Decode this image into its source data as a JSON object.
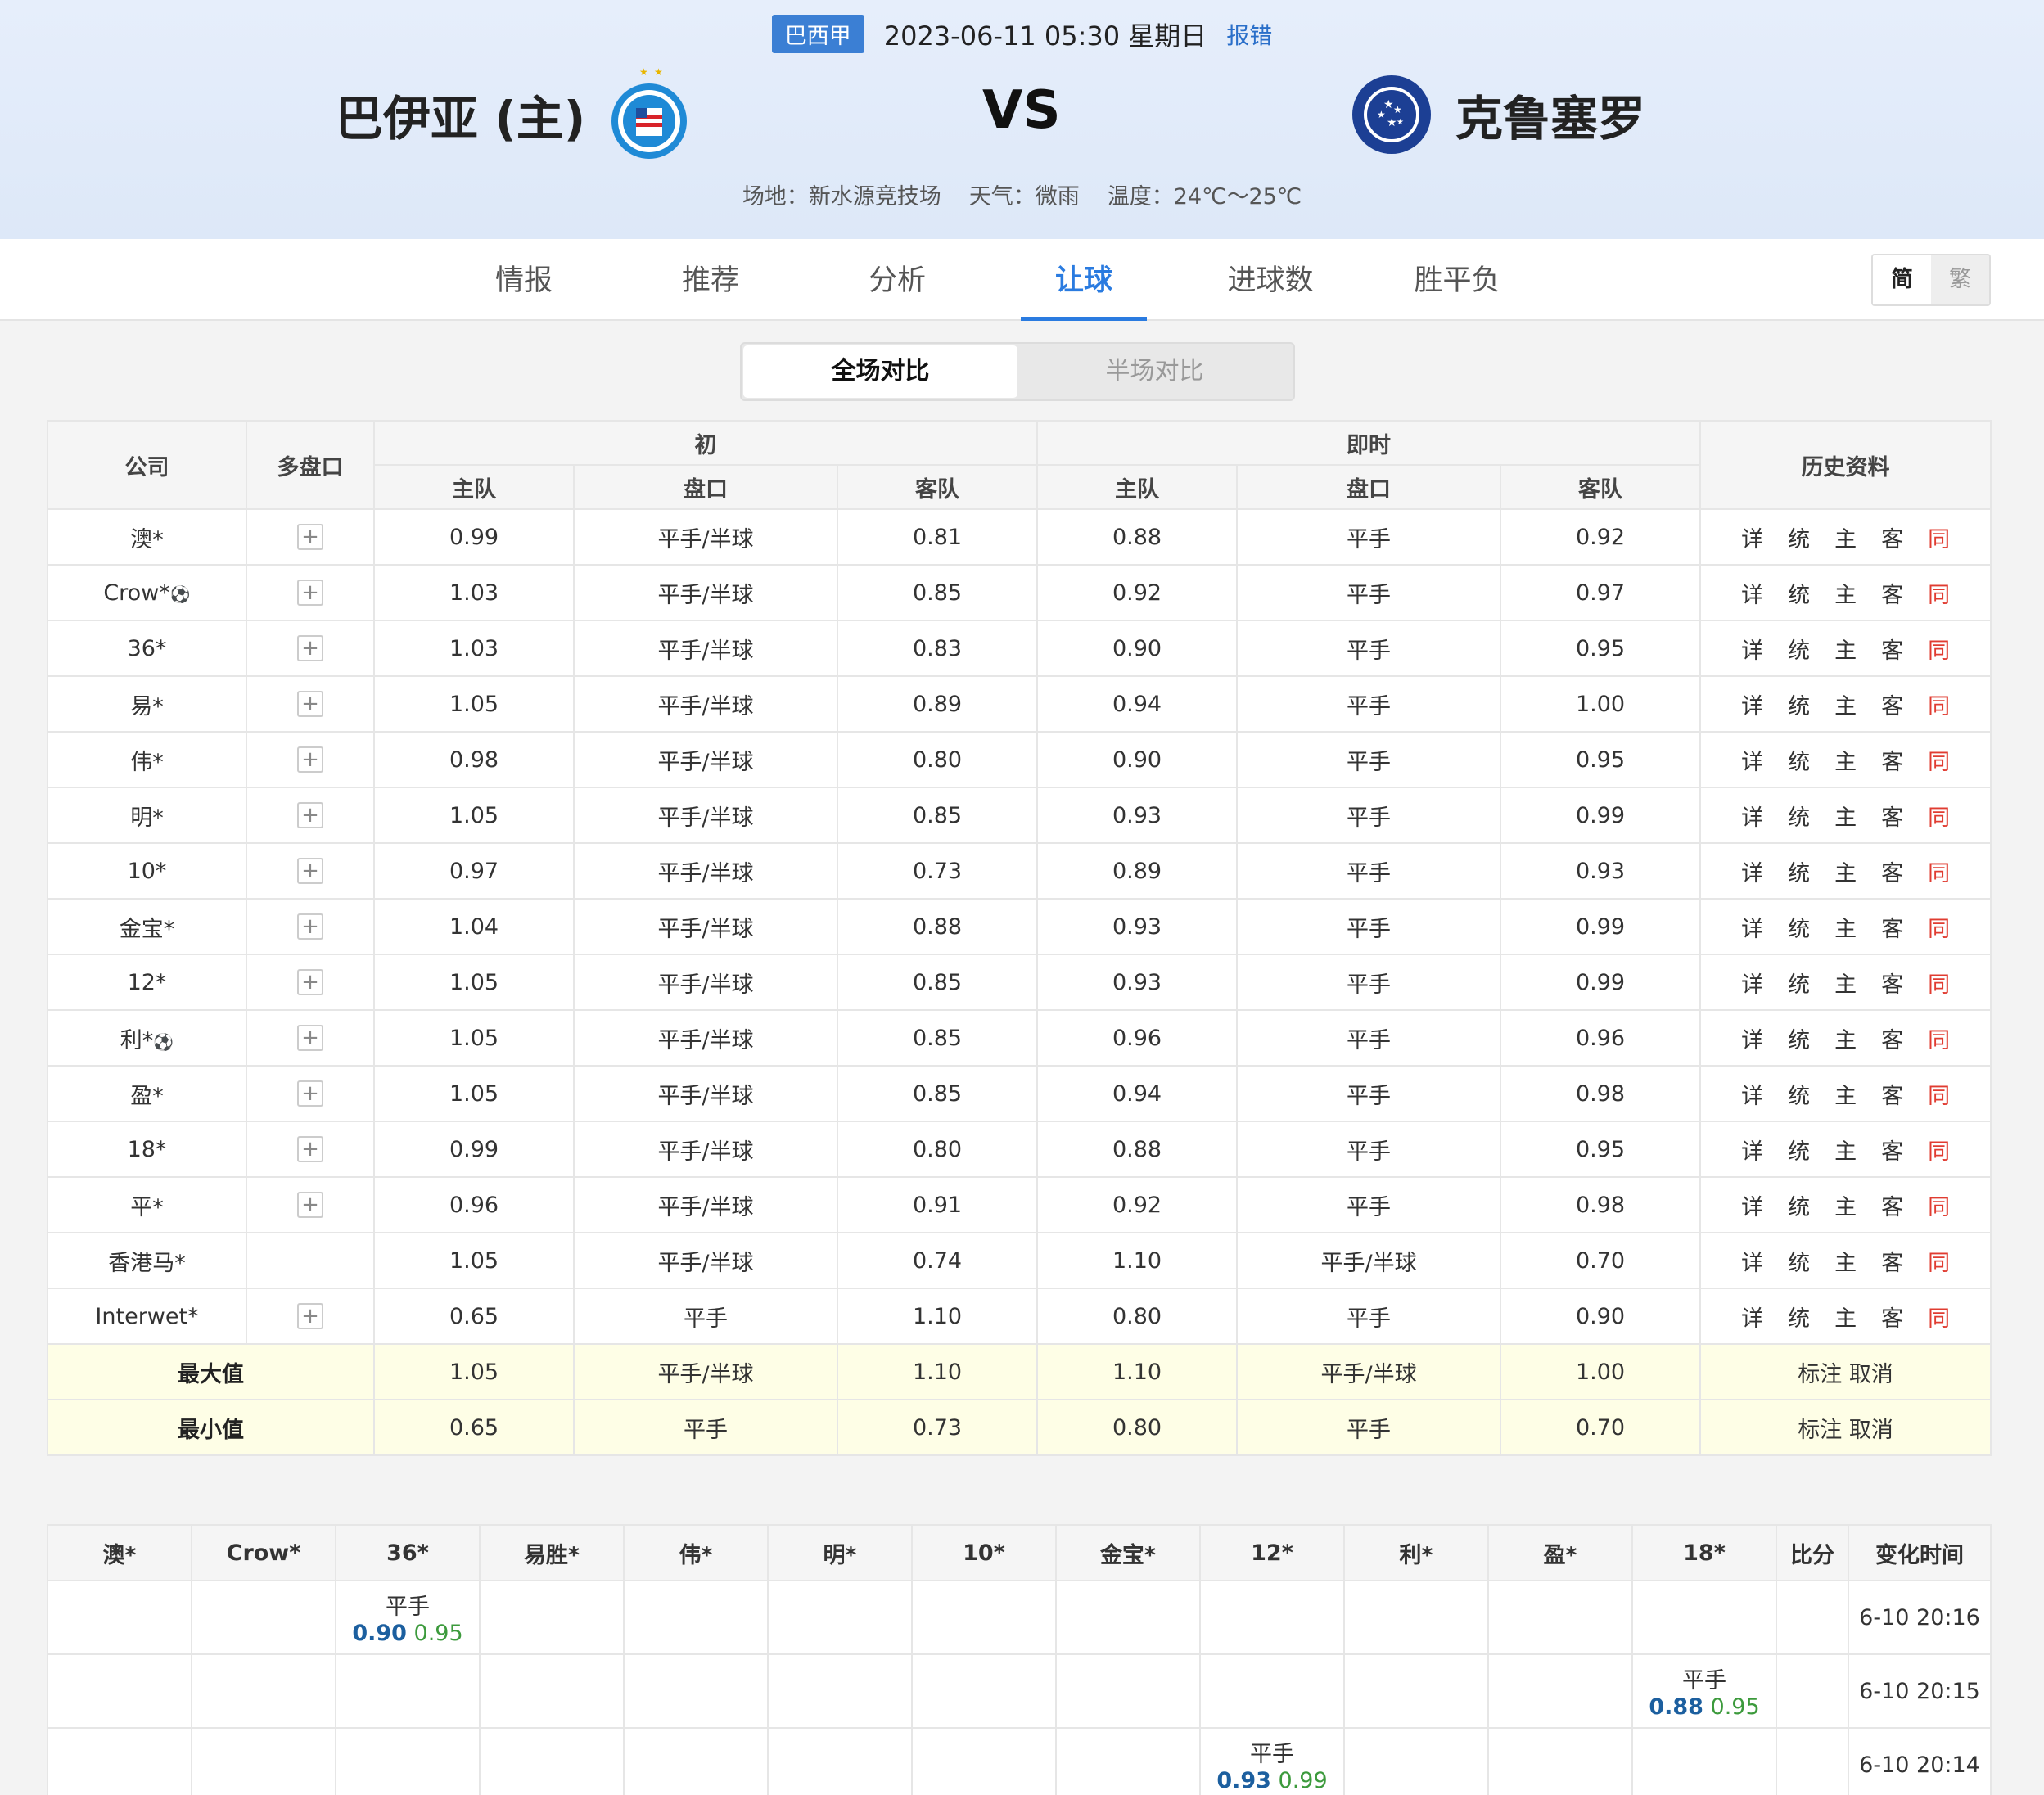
{
  "header": {
    "league": "巴西甲",
    "datetime": "2023-06-11 05:30 星期日",
    "report": "报错",
    "home_team": "巴伊亚 (主)",
    "away_team": "克鲁塞罗",
    "vs": "VS",
    "venue": "场地：新水源竞技场",
    "weather": "天气：微雨",
    "temperature": "温度：24℃～25℃",
    "home_logo_text": "ESPORTE CLUBE BAHIA",
    "away_logo_text": "CRUZEIRO ESPORTE CLUBE"
  },
  "nav": {
    "tabs": [
      "情报",
      "推荐",
      "分析",
      "让球",
      "进球数",
      "胜平负"
    ],
    "active": "让球",
    "lang_simplified": "简",
    "lang_traditional": "繁"
  },
  "segment": {
    "full": "全场对比",
    "half": "半场对比"
  },
  "odds_table": {
    "headers": {
      "company": "公司",
      "multi": "多盘口",
      "initial": "初",
      "live": "即时",
      "history": "历史资料",
      "home": "主队",
      "line": "盘口",
      "away": "客队"
    },
    "history_links": [
      "详",
      "统",
      "主",
      "客",
      "同"
    ],
    "rows": [
      {
        "company": "澳*",
        "ball": "",
        "plus": "+",
        "i_home": "0.99",
        "i_line": "平手/半球",
        "i_away": "0.81",
        "l_home": "0.88",
        "l_line": "平手",
        "l_away": "0.92"
      },
      {
        "company": "Crow*",
        "ball": "⚽",
        "plus": "+",
        "i_home": "1.03",
        "i_line": "平手/半球",
        "i_away": "0.85",
        "l_home": "0.92",
        "l_line": "平手",
        "l_away": "0.97"
      },
      {
        "company": "36*",
        "ball": "",
        "plus": "+",
        "i_home": "1.03",
        "i_line": "平手/半球",
        "i_away": "0.83",
        "l_home": "0.90",
        "l_line": "平手",
        "l_away": "0.95"
      },
      {
        "company": "易*",
        "ball": "",
        "plus": "+",
        "i_home": "1.05",
        "i_line": "平手/半球",
        "i_away": "0.89",
        "l_home": "0.94",
        "l_line": "平手",
        "l_away": "1.00"
      },
      {
        "company": "伟*",
        "ball": "",
        "plus": "+",
        "i_home": "0.98",
        "i_line": "平手/半球",
        "i_away": "0.80",
        "l_home": "0.90",
        "l_line": "平手",
        "l_away": "0.95"
      },
      {
        "company": "明*",
        "ball": "",
        "plus": "+",
        "i_home": "1.05",
        "i_line": "平手/半球",
        "i_away": "0.85",
        "l_home": "0.93",
        "l_line": "平手",
        "l_away": "0.99"
      },
      {
        "company": "10*",
        "ball": "",
        "plus": "+",
        "i_home": "0.97",
        "i_line": "平手/半球",
        "i_away": "0.73",
        "l_home": "0.89",
        "l_line": "平手",
        "l_away": "0.93"
      },
      {
        "company": "金宝*",
        "ball": "",
        "plus": "+",
        "i_home": "1.04",
        "i_line": "平手/半球",
        "i_away": "0.88",
        "l_home": "0.93",
        "l_line": "平手",
        "l_away": "0.99"
      },
      {
        "company": "12*",
        "ball": "",
        "plus": "+",
        "i_home": "1.05",
        "i_line": "平手/半球",
        "i_away": "0.85",
        "l_home": "0.93",
        "l_line": "平手",
        "l_away": "0.99"
      },
      {
        "company": "利*",
        "ball": "⚽",
        "plus": "+",
        "i_home": "1.05",
        "i_line": "平手/半球",
        "i_away": "0.85",
        "l_home": "0.96",
        "l_line": "平手",
        "l_away": "0.96"
      },
      {
        "company": "盈*",
        "ball": "",
        "plus": "+",
        "i_home": "1.05",
        "i_line": "平手/半球",
        "i_away": "0.85",
        "l_home": "0.94",
        "l_line": "平手",
        "l_away": "0.98"
      },
      {
        "company": "18*",
        "ball": "",
        "plus": "+",
        "i_home": "0.99",
        "i_line": "平手/半球",
        "i_away": "0.80",
        "l_home": "0.88",
        "l_line": "平手",
        "l_away": "0.95"
      },
      {
        "company": "平*",
        "ball": "",
        "plus": "+",
        "i_home": "0.96",
        "i_line": "平手/半球",
        "i_away": "0.91",
        "l_home": "0.92",
        "l_line": "平手",
        "l_away": "0.98"
      },
      {
        "company": "香港马*",
        "ball": "",
        "plus": "",
        "i_home": "1.05",
        "i_line": "平手/半球",
        "i_away": "0.74",
        "l_home": "1.10",
        "l_line": "平手/半球",
        "l_away": "0.70"
      },
      {
        "company": "Interwet*",
        "ball": "",
        "plus": "+",
        "i_home": "0.65",
        "i_line": "平手",
        "i_away": "1.10",
        "l_home": "0.80",
        "l_line": "平手",
        "l_away": "0.90"
      }
    ],
    "summary": [
      {
        "label": "最大值",
        "i_home": "1.05",
        "i_line": "平手/半球",
        "i_away": "1.10",
        "l_home": "1.10",
        "l_line": "平手/半球",
        "l_away": "1.00",
        "mark": "标注",
        "cancel": "取消"
      },
      {
        "label": "最小值",
        "i_home": "0.65",
        "i_line": "平手",
        "i_away": "0.73",
        "l_home": "0.80",
        "l_line": "平手",
        "l_away": "0.70",
        "mark": "标注",
        "cancel": "取消"
      }
    ]
  },
  "change_table": {
    "headers": [
      "澳*",
      "Crow*",
      "36*",
      "易胜*",
      "伟*",
      "明*",
      "10*",
      "金宝*",
      "12*",
      "利*",
      "盈*",
      "18*",
      "比分",
      "变化时间"
    ],
    "rows": [
      {
        "col": 2,
        "line": "平手",
        "home": "0.90",
        "away": "0.95",
        "time": "6-10 20:16"
      },
      {
        "col": 11,
        "line": "平手",
        "home": "0.88",
        "away": "0.95",
        "time": "6-10 20:15"
      },
      {
        "col": 8,
        "line": "平手",
        "home": "0.93",
        "away": "0.99",
        "time": "6-10 20:14"
      }
    ]
  },
  "colors": {
    "accent": "#2a7be0",
    "league_badge": "#3b7fd4",
    "history_red": "#e03c31",
    "home_odd": "#1c5f9f",
    "away_odd": "#3c9a3c",
    "summary_bg": "#fefee6"
  }
}
